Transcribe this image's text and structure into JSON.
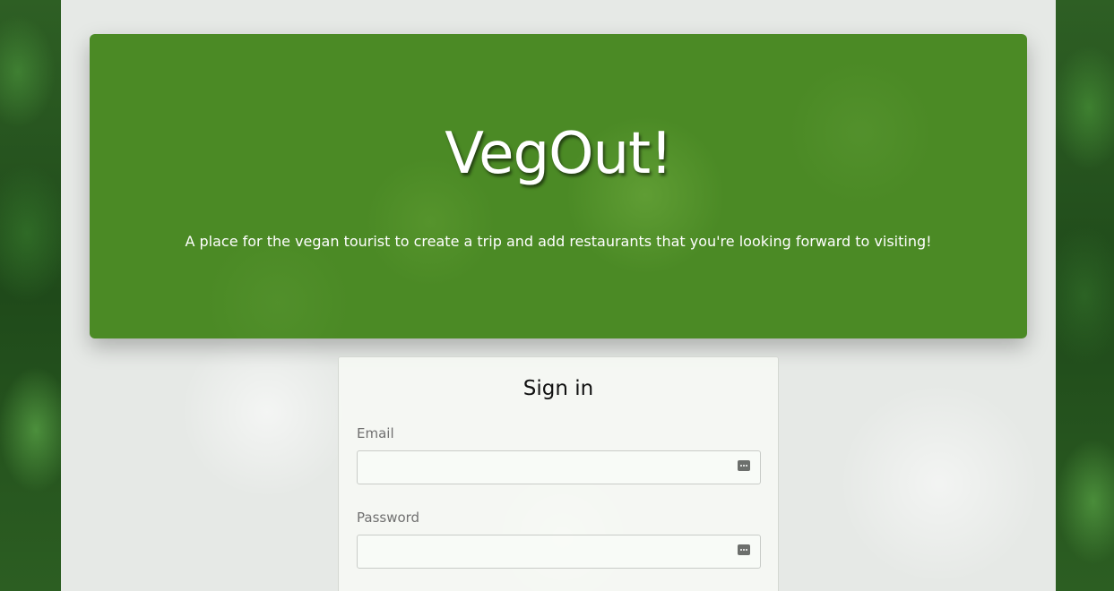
{
  "hero": {
    "title": "VegOut!",
    "tagline": "A place for the vegan tourist to create a trip and add restaurants that you're looking forward to visiting!"
  },
  "signin": {
    "title": "Sign in",
    "email_label": "Email",
    "email_value": "",
    "password_label": "Password",
    "password_value": ""
  },
  "colors": {
    "hero_green": "#4b8a25",
    "panel_background": "#e6e9e6",
    "field_label": "#707070"
  },
  "icons": {
    "email_field_icon": "autofill-key-icon",
    "password_field_icon": "autofill-key-icon"
  }
}
